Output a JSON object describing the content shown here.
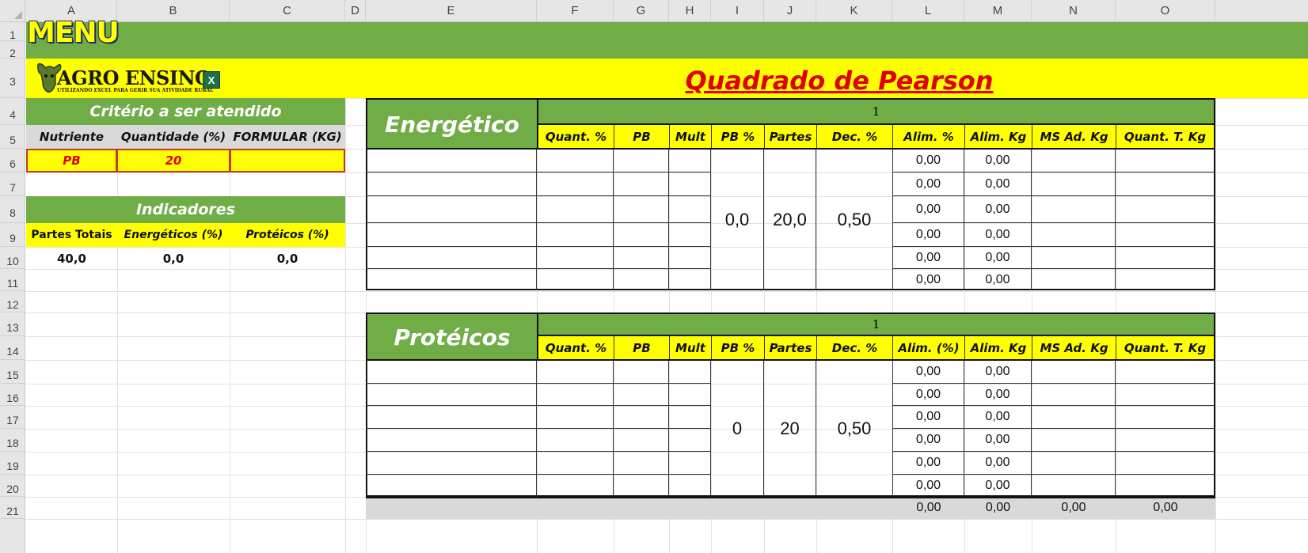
{
  "columns": [
    "A",
    "B",
    "C",
    "D",
    "E",
    "F",
    "G",
    "H",
    "I",
    "J",
    "K",
    "L",
    "M",
    "N",
    "O"
  ],
  "rows": [
    "1",
    "2",
    "3",
    "4",
    "5",
    "6",
    "7",
    "8",
    "9",
    "10",
    "11",
    "12",
    "13",
    "14",
    "15",
    "16",
    "17",
    "18",
    "19",
    "20",
    "21"
  ],
  "menu_label": "MENU",
  "logo": {
    "name": "AGRO ENSINO",
    "tagline": "UTILIZANDO EXCEL PARA GERIR SUA ATIVIDADE RURAL",
    "x_badge": "X"
  },
  "title": "Quadrado de Pearson",
  "criterio": {
    "heading": "Critério a ser atendido",
    "headers": [
      "Nutriente",
      "Quantidade (%)",
      "FORMULAR (KG)"
    ],
    "values": [
      "PB",
      "20",
      ""
    ]
  },
  "indicadores": {
    "heading": "Indicadores",
    "headers": [
      "Partes Totais",
      "Energéticos (%)",
      "Protéicos (%)"
    ],
    "values": [
      "40,0",
      "0,0",
      "0,0"
    ]
  },
  "energetico": {
    "name": "Energético",
    "group": "1",
    "headers": [
      "Quant. %",
      "PB",
      "Mult",
      "PB %",
      "Partes",
      "Dec. %",
      "Alim. %",
      "Alim. Kg",
      "MS Ad. Kg",
      "Quant. T. Kg"
    ],
    "pb_pct": "0,0",
    "partes": "20,0",
    "dec_pct": "0,50",
    "alim_pct": [
      "0,00",
      "0,00",
      "0,00",
      "0,00",
      "0,00",
      "0,00"
    ],
    "alim_kg": [
      "0,00",
      "0,00",
      "0,00",
      "0,00",
      "0,00",
      "0,00"
    ]
  },
  "proteicos": {
    "name": "Protéicos",
    "group": "1",
    "headers": [
      "Quant. %",
      "PB",
      "Mult",
      "PB %",
      "Partes",
      "Dec. %",
      "Alim. (%)",
      "Alim. Kg",
      "MS Ad. Kg",
      "Quant. T. Kg"
    ],
    "pb_pct": "0",
    "partes": "20",
    "dec_pct": "0,50",
    "alim_pct": [
      "0,00",
      "0,00",
      "0,00",
      "0,00",
      "0,00",
      "0,00"
    ],
    "alim_kg": [
      "0,00",
      "0,00",
      "0,00",
      "0,00",
      "0,00",
      "0,00"
    ]
  },
  "totals": [
    "0,00",
    "0,00",
    "0,00",
    "0,00"
  ],
  "colors": {
    "green": "#70ad47",
    "yellow": "#ffff00",
    "red": "#e00000",
    "total_gray": "#d9d9d9"
  }
}
